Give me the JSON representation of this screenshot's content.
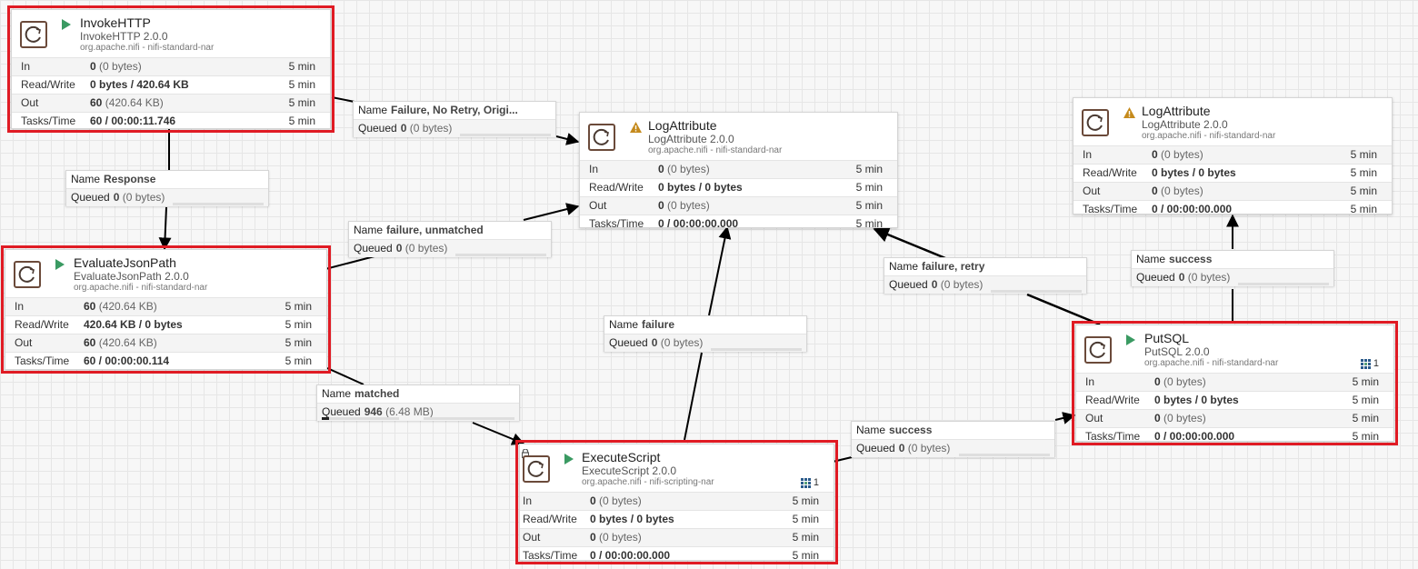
{
  "colors": {
    "selection": "#e01b24",
    "running": "#3a9a62",
    "warning": "#c58a1c",
    "connector": "#000000"
  },
  "processors": {
    "invoke_http": {
      "name": "InvokeHTTP",
      "type": "InvokeHTTP 2.0.0",
      "bundle": "org.apache.nifi - nifi-standard-nar",
      "state_icon": "play-icon",
      "stats": [
        {
          "label": "In",
          "value": "0",
          "detail": "(0 bytes)",
          "time": "5 min"
        },
        {
          "label": "Read/Write",
          "value": "0 bytes / 420.64 KB",
          "detail": "",
          "time": "5 min"
        },
        {
          "label": "Out",
          "value": "60",
          "detail": "(420.64 KB)",
          "time": "5 min"
        },
        {
          "label": "Tasks/Time",
          "value": "60 / 00:00:11.746",
          "detail": "",
          "time": "5 min"
        }
      ]
    },
    "evaluate_json_path": {
      "name": "EvaluateJsonPath",
      "type": "EvaluateJsonPath 2.0.0",
      "bundle": "org.apache.nifi - nifi-standard-nar",
      "state_icon": "play-icon",
      "stats": [
        {
          "label": "In",
          "value": "60",
          "detail": "(420.64 KB)",
          "time": "5 min"
        },
        {
          "label": "Read/Write",
          "value": "420.64 KB / 0 bytes",
          "detail": "",
          "time": "5 min"
        },
        {
          "label": "Out",
          "value": "60",
          "detail": "(420.64 KB)",
          "time": "5 min"
        },
        {
          "label": "Tasks/Time",
          "value": "60 / 00:00:00.114",
          "detail": "",
          "time": "5 min"
        }
      ]
    },
    "log_attribute_1": {
      "name": "LogAttribute",
      "type": "LogAttribute 2.0.0",
      "bundle": "org.apache.nifi - nifi-standard-nar",
      "state_icon": "warning-icon",
      "stats": [
        {
          "label": "In",
          "value": "0",
          "detail": "(0 bytes)",
          "time": "5 min"
        },
        {
          "label": "Read/Write",
          "value": "0 bytes / 0 bytes",
          "detail": "",
          "time": "5 min"
        },
        {
          "label": "Out",
          "value": "0",
          "detail": "(0 bytes)",
          "time": "5 min"
        },
        {
          "label": "Tasks/Time",
          "value": "0 / 00:00:00.000",
          "detail": "",
          "time": "5 min"
        }
      ]
    },
    "log_attribute_2": {
      "name": "LogAttribute",
      "type": "LogAttribute 2.0.0",
      "bundle": "org.apache.nifi - nifi-standard-nar",
      "state_icon": "warning-icon",
      "stats": [
        {
          "label": "In",
          "value": "0",
          "detail": "(0 bytes)",
          "time": "5 min"
        },
        {
          "label": "Read/Write",
          "value": "0 bytes / 0 bytes",
          "detail": "",
          "time": "5 min"
        },
        {
          "label": "Out",
          "value": "0",
          "detail": "(0 bytes)",
          "time": "5 min"
        },
        {
          "label": "Tasks/Time",
          "value": "0 / 00:00:00.000",
          "detail": "",
          "time": "5 min"
        }
      ]
    },
    "put_sql": {
      "name": "PutSQL",
      "type": "PutSQL 2.0.0",
      "bundle": "org.apache.nifi - nifi-standard-nar",
      "state_icon": "play-icon",
      "threads": "1",
      "stats": [
        {
          "label": "In",
          "value": "0",
          "detail": "(0 bytes)",
          "time": "5 min"
        },
        {
          "label": "Read/Write",
          "value": "0 bytes / 0 bytes",
          "detail": "",
          "time": "5 min"
        },
        {
          "label": "Out",
          "value": "0",
          "detail": "(0 bytes)",
          "time": "5 min"
        },
        {
          "label": "Tasks/Time",
          "value": "0 / 00:00:00.000",
          "detail": "",
          "time": "5 min"
        }
      ]
    },
    "execute_script": {
      "name": "ExecuteScript",
      "type": "ExecuteScript 2.0.0",
      "bundle": "org.apache.nifi - nifi-scripting-nar",
      "state_icon": "play-icon",
      "threads": "1",
      "stats": [
        {
          "label": "In",
          "value": "0",
          "detail": "(0 bytes)",
          "time": "5 min"
        },
        {
          "label": "Read/Write",
          "value": "0 bytes / 0 bytes",
          "detail": "",
          "time": "5 min"
        },
        {
          "label": "Out",
          "value": "0",
          "detail": "(0 bytes)",
          "time": "5 min"
        },
        {
          "label": "Tasks/Time",
          "value": "0 / 00:00:00.000",
          "detail": "",
          "time": "5 min"
        }
      ]
    }
  },
  "connections": {
    "invoke_failure": {
      "name_key": "Name",
      "name": "Failure, No Retry, Origi...",
      "queued_key": "Queued",
      "queued_count": "0",
      "queued_size": "(0 bytes)",
      "fill": 0
    },
    "response": {
      "name_key": "Name",
      "name": "Response",
      "queued_key": "Queued",
      "queued_count": "0",
      "queued_size": "(0 bytes)",
      "fill": 0
    },
    "failure_unmatched": {
      "name_key": "Name",
      "name": "failure, unmatched",
      "queued_key": "Queued",
      "queued_count": "0",
      "queued_size": "(0 bytes)",
      "fill": 0
    },
    "matched": {
      "name_key": "Name",
      "name": "matched",
      "queued_key": "Queued",
      "queued_count": "946",
      "queued_size": "(6.48 MB)",
      "fill": 0.09
    },
    "script_failure": {
      "name_key": "Name",
      "name": "failure",
      "queued_key": "Queued",
      "queued_count": "0",
      "queued_size": "(0 bytes)",
      "fill": 0
    },
    "script_success": {
      "name_key": "Name",
      "name": "success",
      "queued_key": "Queued",
      "queued_count": "0",
      "queued_size": "(0 bytes)",
      "fill": 0
    },
    "failure_retry": {
      "name_key": "Name",
      "name": "failure, retry",
      "queued_key": "Queued",
      "queued_count": "0",
      "queued_size": "(0 bytes)",
      "fill": 0
    },
    "sql_success": {
      "name_key": "Name",
      "name": "success",
      "queued_key": "Queued",
      "queued_count": "0",
      "queued_size": "(0 bytes)",
      "fill": 0
    }
  }
}
